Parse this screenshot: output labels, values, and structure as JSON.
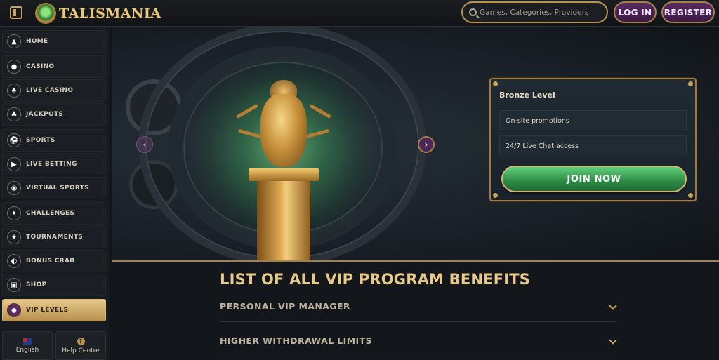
{
  "header": {
    "logo_text": "TALISMANIA",
    "search_placeholder": "Games, Categories, Providers",
    "login_label": "LOG IN",
    "register_label": "REGISTER"
  },
  "sidebar": {
    "items": [
      {
        "label": "HOME",
        "icon": "home-icon",
        "active": false
      },
      {
        "label": "CASINO",
        "icon": "casino-icon",
        "active": false
      },
      {
        "label": "LIVE CASINO",
        "icon": "live-casino-icon",
        "active": false
      },
      {
        "label": "JACKPOTS",
        "icon": "jackpots-icon",
        "active": false
      },
      {
        "label": "SPORTS",
        "icon": "sports-icon",
        "active": false
      },
      {
        "label": "LIVE BETTING",
        "icon": "live-betting-icon",
        "active": false
      },
      {
        "label": "VIRTUAL SPORTS",
        "icon": "virtual-sports-icon",
        "active": false
      },
      {
        "label": "CHALLENGES",
        "icon": "challenges-icon",
        "active": false
      },
      {
        "label": "TOURNAMENTS",
        "icon": "tournaments-icon",
        "active": false
      },
      {
        "label": "BONUS CRAB",
        "icon": "bonus-crab-icon",
        "active": false
      },
      {
        "label": "SHOP",
        "icon": "shop-icon",
        "active": false
      },
      {
        "label": "VIP LEVELS",
        "icon": "diamond-icon",
        "active": true
      }
    ],
    "language_label": "English",
    "help_label": "Help Centre"
  },
  "vip_card": {
    "level_title": "Bronze Level",
    "benefits": [
      "On-site promotions",
      "24/7 Live Chat access"
    ],
    "join_label": "JOIN NOW"
  },
  "benefits_list": {
    "title": "LIST OF ALL VIP PROGRAM BENEFITS",
    "items": [
      "PERSONAL VIP MANAGER",
      "HIGHER WITHDRAWAL LIMITS"
    ]
  },
  "colors": {
    "accent_gold": "#c9a45a",
    "button_purple": "#4a2755",
    "join_green": "#2d8a45"
  }
}
